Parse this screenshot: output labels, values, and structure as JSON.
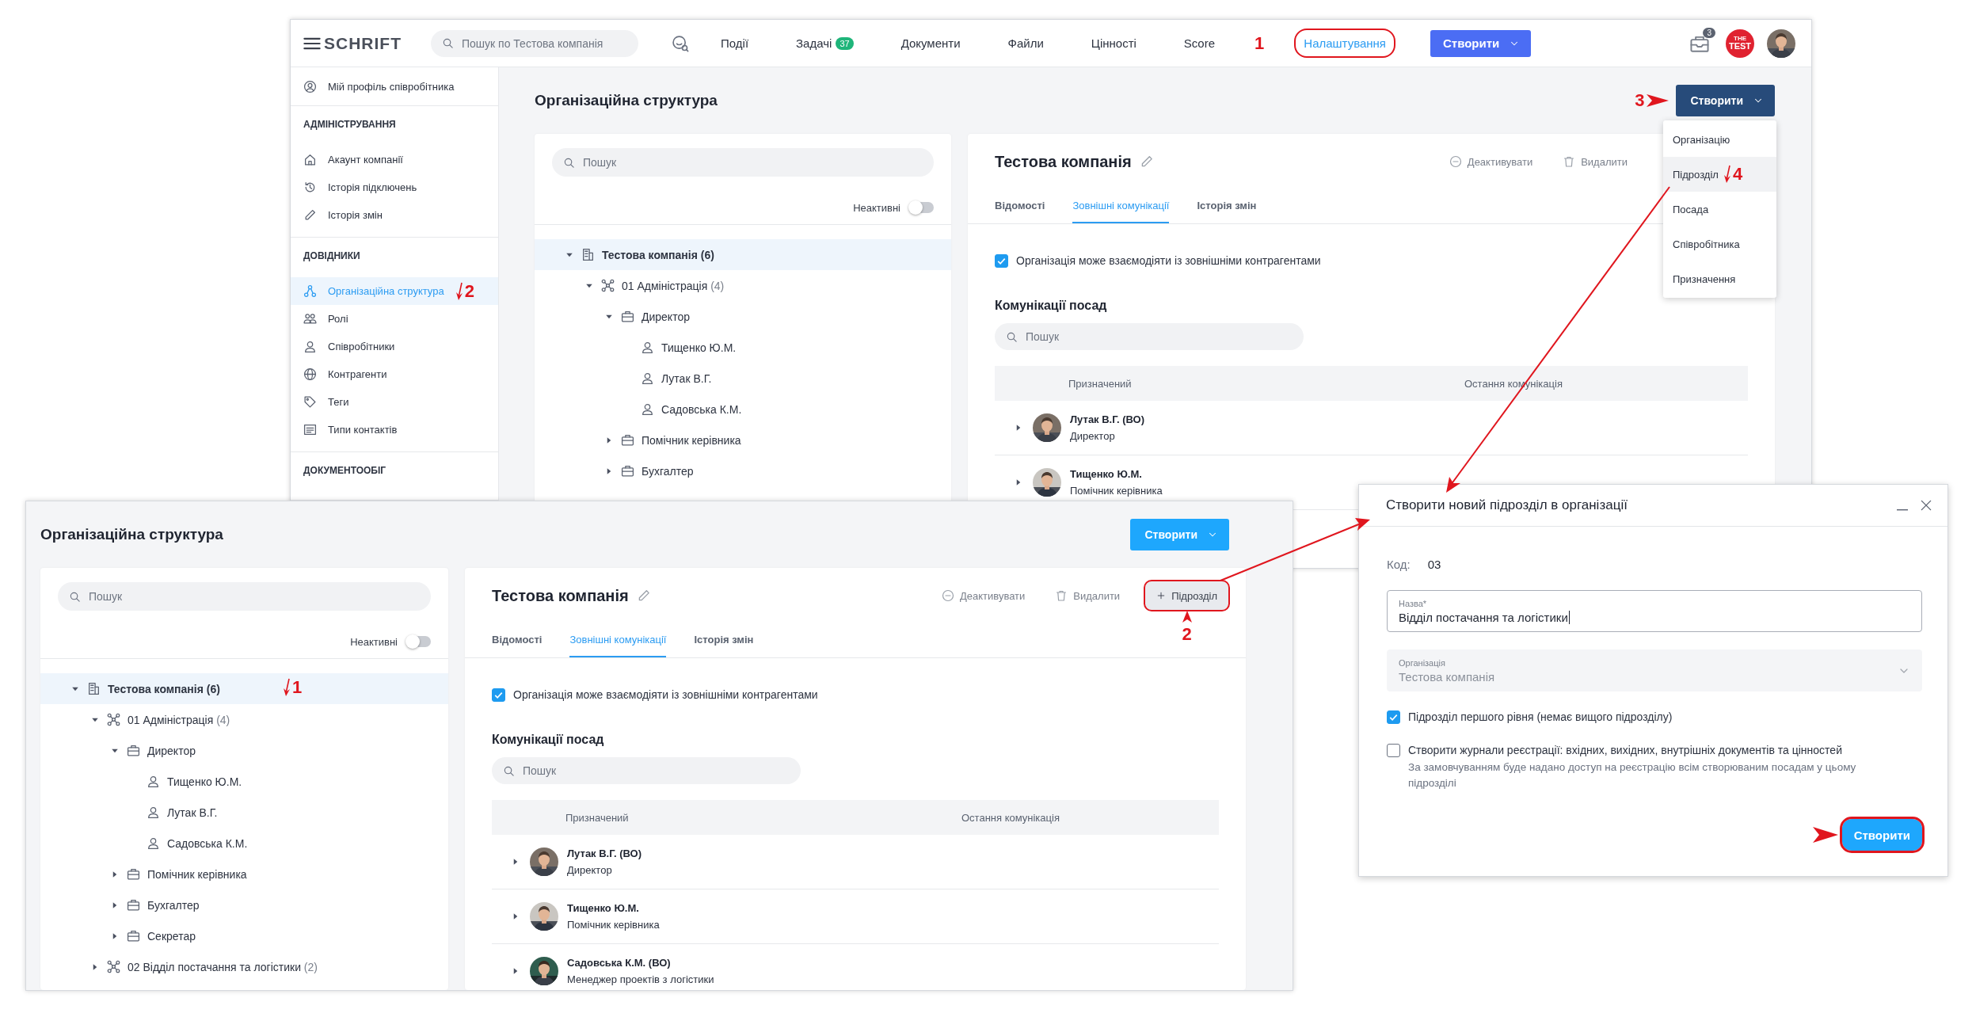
{
  "main_screen": {
    "header": {
      "logo": "SCHRIFT",
      "search": {
        "placeholder": "Пошук по Тестова компанія"
      },
      "nav": [
        {
          "label": "Події",
          "selected": false,
          "highlighted": false
        },
        {
          "label": "Задачі",
          "badge": "37",
          "selected": false,
          "highlighted": false
        },
        {
          "label": "Документи",
          "selected": false,
          "highlighted": false
        },
        {
          "label": "Файли",
          "selected": false,
          "highlighted": false
        },
        {
          "label": "Цінності",
          "selected": false,
          "highlighted": false
        },
        {
          "label": "Score",
          "selected": false,
          "highlighted": false
        },
        {
          "label": "Налаштування",
          "selected": true,
          "highlighted": true,
          "marker": "1"
        }
      ],
      "create_button": "Створити",
      "notification_count": "3",
      "company_logo": {
        "top": "THE",
        "text": "TEST"
      }
    },
    "sidebar": {
      "profile": "Мій профіль співробітника",
      "sections": [
        {
          "title": "АДМІНІСТРУВАННЯ",
          "items": [
            {
              "label": "Акаунт компанії",
              "selected": false
            },
            {
              "label": "Історія підключень",
              "selected": false
            },
            {
              "label": "Історія змін",
              "selected": false
            }
          ]
        },
        {
          "title": "ДОВІДНИКИ",
          "items": [
            {
              "label": "Організаційна структура",
              "selected": true,
              "marker": "2"
            },
            {
              "label": "Ролі",
              "selected": false
            },
            {
              "label": "Співробітники",
              "selected": false
            },
            {
              "label": "Контрагенти",
              "selected": false
            },
            {
              "label": "Теги",
              "selected": false
            },
            {
              "label": "Типи контактів",
              "selected": false
            }
          ]
        },
        {
          "title": "ДОКУМЕНТООБІГ"
        }
      ]
    },
    "page_title": "Організаційна структура",
    "create_button": {
      "label": "Створити",
      "marker": "3"
    },
    "create_menu": [
      {
        "label": "Організацію",
        "selected": false
      },
      {
        "label": "Підрозділ",
        "selected": true,
        "marker": "4"
      },
      {
        "label": "Посада",
        "selected": false
      },
      {
        "label": "Співробітника",
        "selected": false
      },
      {
        "label": "Призначення",
        "selected": false
      }
    ],
    "tree_panel": {
      "search": {
        "placeholder": "Пошук"
      },
      "inactive_toggle": {
        "label": "Неактивні",
        "on": false
      },
      "tree": [
        {
          "kind": "company",
          "label": "Тестова компанія",
          "count": "(6)",
          "expanded": true,
          "selected": true,
          "children": [
            {
              "kind": "department",
              "label": "01 Адміністрація",
              "count": "(4)",
              "expanded": true,
              "selected": false,
              "children": [
                {
                  "kind": "position",
                  "label": "Директор",
                  "expanded": true,
                  "selected": false,
                  "children": [
                    {
                      "kind": "person",
                      "label": "Тищенко Ю.М.",
                      "selected": false
                    },
                    {
                      "kind": "person",
                      "label": "Лутак В.Г.",
                      "selected": false
                    },
                    {
                      "kind": "person",
                      "label": "Садовська К.М.",
                      "selected": false
                    }
                  ]
                },
                {
                  "kind": "position",
                  "label": "Помічник керівника",
                  "expanded": false,
                  "selected": false
                },
                {
                  "kind": "position",
                  "label": "Бухгалтер",
                  "expanded": false,
                  "selected": false
                }
              ]
            }
          ]
        }
      ]
    },
    "detail_panel": {
      "title": "Тестова компанія",
      "actions": [
        {
          "kind": "deactivate",
          "label": "Деактивувати"
        },
        {
          "kind": "delete",
          "label": "Видалити"
        }
      ],
      "tabs": [
        {
          "label": "Відомості",
          "selected": false
        },
        {
          "label": "Зовнішні комунікації",
          "selected": true
        },
        {
          "label": "Історія змін",
          "selected": false
        }
      ],
      "external_checkbox": {
        "label": "Організація може взаємодіяти із зовнішніми контрагентами",
        "checked": true
      },
      "section_title": "Комунікації посад",
      "search": {
        "placeholder": "Пошук"
      },
      "table": {
        "columns": [
          "Призначений",
          "Остання комунікація"
        ],
        "rows": [
          {
            "name": "Лутак В.Г. (ВО)",
            "role": "Директор"
          },
          {
            "name": "Тищенко Ю.М.",
            "role": "Помічник керівника"
          }
        ]
      }
    }
  },
  "detail_screen": {
    "page_title": "Організаційна структура",
    "create_button": {
      "label": "Створити"
    },
    "tree_panel": {
      "search": {
        "placeholder": "Пошук"
      },
      "inactive_toggle": {
        "label": "Неактивні",
        "on": false
      },
      "tree": [
        {
          "kind": "company",
          "label": "Тестова компанія",
          "count": "(6)",
          "expanded": true,
          "selected": true,
          "marker": "1",
          "children": [
            {
              "kind": "department",
              "label": "01 Адміністрація",
              "count": "(4)",
              "expanded": true,
              "selected": false,
              "children": [
                {
                  "kind": "position",
                  "label": "Директор",
                  "expanded": true,
                  "selected": false,
                  "children": [
                    {
                      "kind": "person",
                      "label": "Тищенко Ю.М.",
                      "selected": false
                    },
                    {
                      "kind": "person",
                      "label": "Лутак В.Г.",
                      "selected": false
                    },
                    {
                      "kind": "person",
                      "label": "Садовська К.М.",
                      "selected": false
                    }
                  ]
                },
                {
                  "kind": "position",
                  "label": "Помічник керівника",
                  "expanded": false,
                  "selected": false
                },
                {
                  "kind": "position",
                  "label": "Бухгалтер",
                  "expanded": false,
                  "selected": false
                },
                {
                  "kind": "position",
                  "label": "Секретар",
                  "expanded": false,
                  "selected": false
                }
              ]
            },
            {
              "kind": "department",
              "label": "02 Відділ постачання та логістики",
              "count": "(2)",
              "expanded": false,
              "selected": false
            }
          ]
        }
      ]
    },
    "detail_panel": {
      "title": "Тестова компанія",
      "actions": [
        {
          "kind": "deactivate",
          "label": "Деактивувати"
        },
        {
          "kind": "delete",
          "label": "Видалити"
        },
        {
          "kind": "add",
          "label": "Підрозділ",
          "highlighted": true,
          "marker": "2"
        }
      ],
      "tabs": [
        {
          "label": "Відомості",
          "selected": false
        },
        {
          "label": "Зовнішні комунікації",
          "selected": true
        },
        {
          "label": "Історія змін",
          "selected": false
        }
      ],
      "external_checkbox": {
        "label": "Організація може взаємодіяти із зовнішніми контрагентами",
        "checked": true
      },
      "section_title": "Комунікації посад",
      "search": {
        "placeholder": "Пошук"
      },
      "table": {
        "columns": [
          "Призначений",
          "Остання комунікація"
        ],
        "rows": [
          {
            "name": "Лутак В.Г. (ВО)",
            "role": "Директор"
          },
          {
            "name": "Тищенко Ю.М.",
            "role": "Помічник керівника"
          },
          {
            "name": "Садовська К.М. (ВО)",
            "role": "Менеджер проектів з логістики"
          }
        ]
      }
    }
  },
  "dialog": {
    "title": "Створити новий підрозділ в організації",
    "code": {
      "label": "Код:",
      "value": "03"
    },
    "name_field": {
      "label": "Назва*",
      "value": "Відділ постачання та логістики"
    },
    "organization_select": {
      "label": "Організація",
      "value": "Тестова компанія",
      "disabled": true
    },
    "options": [
      {
        "label": "Підрозділ першого рівня (немає вищого підрозділу)",
        "checked": true
      },
      {
        "label": "Створити журнали реєстрації: вхідних, вихідних, внутрішніх документів та цінностей",
        "checked": false,
        "hint": "За замовчуванням буде надано доступ на реєстрацію всім створюваним посадам у цьому підрозділі"
      }
    ],
    "create_button": {
      "label": "Створити",
      "highlighted": true
    }
  }
}
